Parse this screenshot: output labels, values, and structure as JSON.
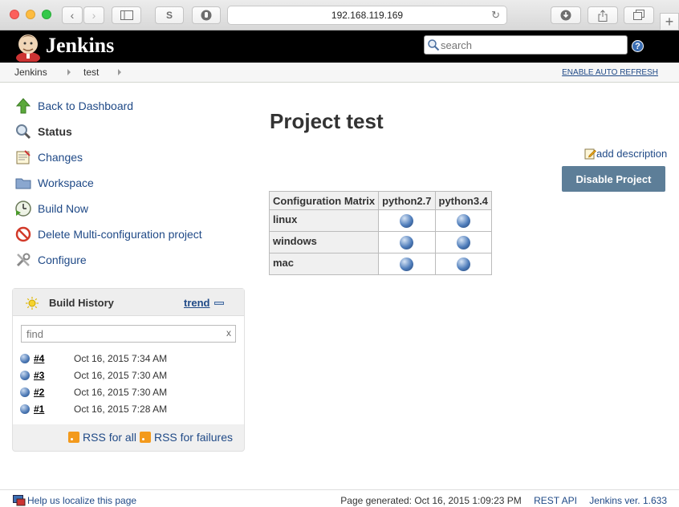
{
  "browser": {
    "url": "192.168.119.169",
    "toolbar_s_label": "S"
  },
  "header": {
    "app_name": "Jenkins",
    "search_placeholder": "search",
    "help_label": "?"
  },
  "breadcrumb": {
    "items": [
      "Jenkins",
      "test"
    ],
    "auto_refresh": "ENABLE AUTO REFRESH"
  },
  "sidebar": {
    "tasks": [
      {
        "label": "Back to Dashboard",
        "icon": "up-arrow-icon"
      },
      {
        "label": "Status",
        "icon": "magnifier-icon"
      },
      {
        "label": "Changes",
        "icon": "notepad-icon"
      },
      {
        "label": "Workspace",
        "icon": "folder-icon"
      },
      {
        "label": "Build Now",
        "icon": "clock-play-icon"
      },
      {
        "label": "Delete Multi-configuration project",
        "icon": "no-entry-icon"
      },
      {
        "label": "Configure",
        "icon": "tools-icon"
      }
    ]
  },
  "build_history": {
    "title": "Build History",
    "trend_label": "trend",
    "find_placeholder": "find",
    "clear_label": "x",
    "builds": [
      {
        "number": "#4",
        "date": "Oct 16, 2015 7:34 AM"
      },
      {
        "number": "#3",
        "date": "Oct 16, 2015 7:30 AM"
      },
      {
        "number": "#2",
        "date": "Oct 16, 2015 7:30 AM"
      },
      {
        "number": "#1",
        "date": "Oct 16, 2015 7:28 AM"
      }
    ],
    "rss_all": "RSS for all",
    "rss_failures": "RSS for failures"
  },
  "main": {
    "title": "Project test",
    "add_description": "add description",
    "disable_button": "Disable Project",
    "matrix": {
      "corner": "Configuration Matrix",
      "columns": [
        "python2.7",
        "python3.4"
      ],
      "rows": [
        "linux",
        "windows",
        "mac"
      ]
    }
  },
  "footer": {
    "localize": "Help us localize this page",
    "generated": "Page generated: Oct 16, 2015 1:09:23 PM",
    "rest_api": "REST API",
    "version": "Jenkins ver. 1.633"
  },
  "colors": {
    "link": "#204a87",
    "disable_button": "#5d7e98",
    "header_bg": "#000000",
    "build_ball": "#4a77b4"
  }
}
